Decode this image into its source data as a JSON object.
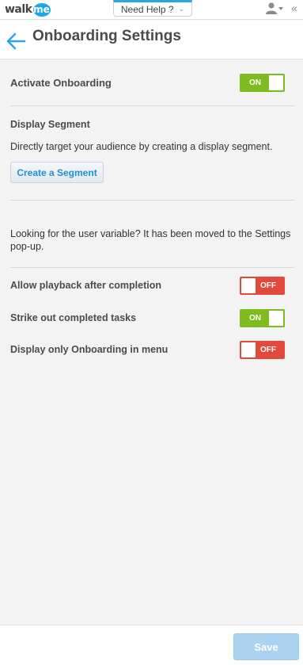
{
  "app": {
    "logo_text": "walk",
    "logo_badge": "me",
    "help_tab": "Need Help ?",
    "help_chevron": "⌄",
    "collapse_icon": "«"
  },
  "header": {
    "title": "Onboarding Settings",
    "back_icon": "arrow-left-icon"
  },
  "settings": {
    "activate_onboarding": {
      "label": "Activate Onboarding",
      "state": "ON"
    },
    "display_segment": {
      "heading": "Display Segment",
      "description": "Directly target your audience by creating a display segment.",
      "button": "Create a Segment"
    },
    "user_variable_note": "Looking for the user variable? It has been moved to the Settings pop-up.",
    "allow_playback": {
      "label": "Allow playback after completion",
      "state": "OFF"
    },
    "strike_out": {
      "label": "Strike out completed tasks",
      "state": "ON"
    },
    "display_only": {
      "label": "Display only Onboarding in menu",
      "state": "OFF"
    }
  },
  "footer": {
    "save": "Save"
  },
  "colors": {
    "toggle_on": "#7dbb1f",
    "toggle_off": "#e2493a",
    "accent": "#29a8e0",
    "save_disabled": "#a9d3ef"
  }
}
